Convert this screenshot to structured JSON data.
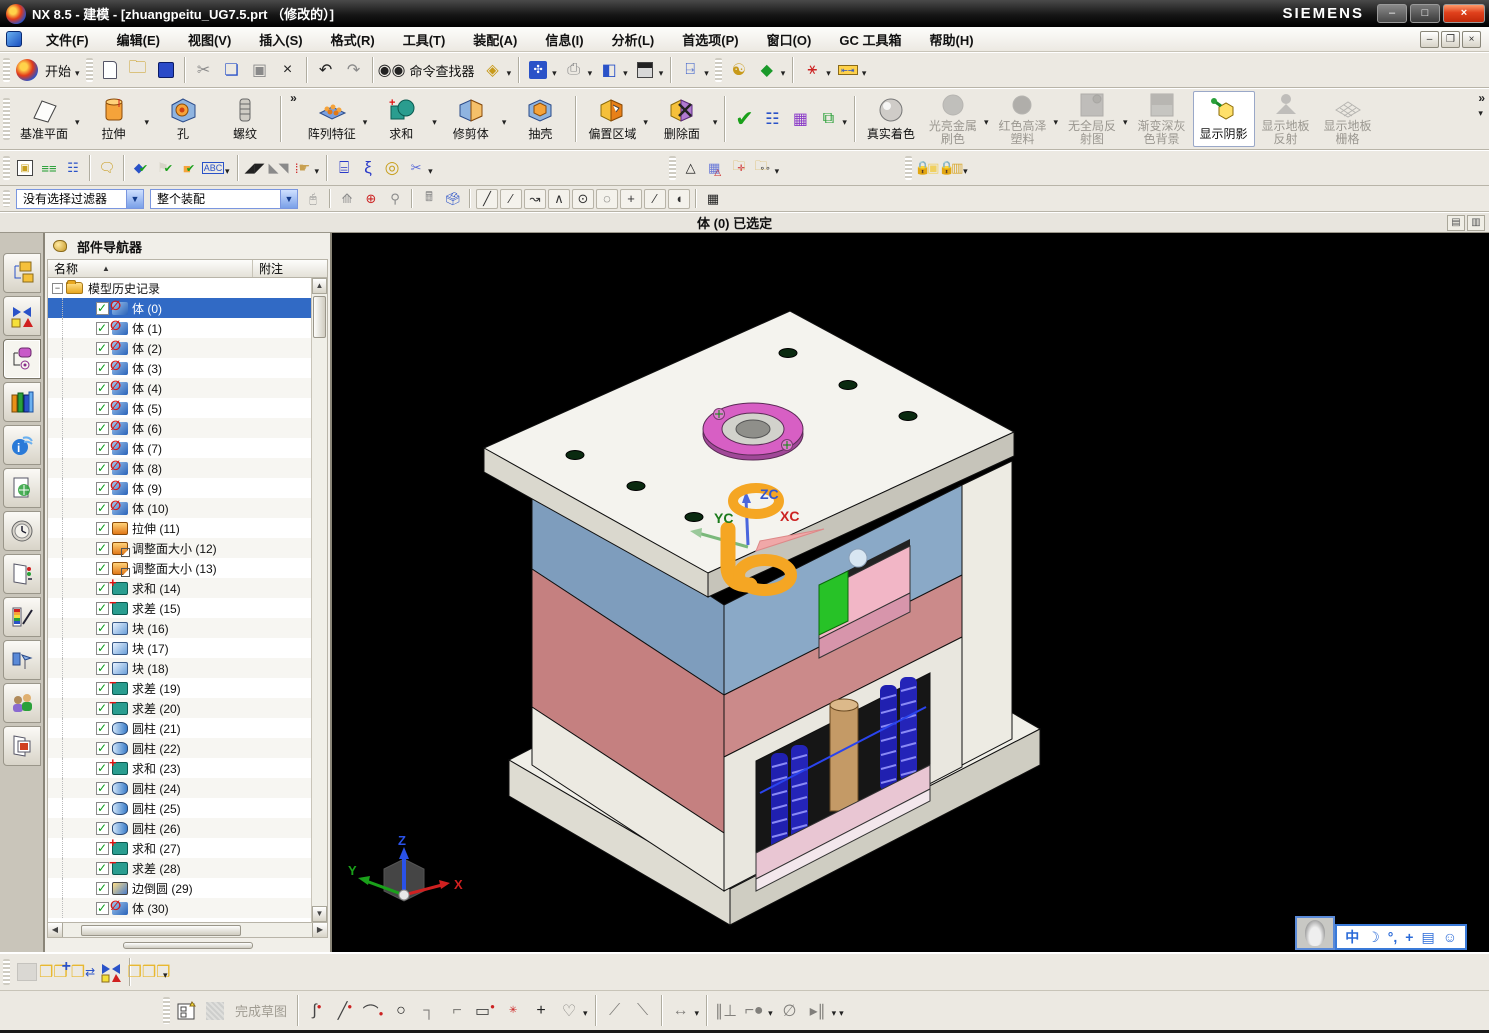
{
  "window": {
    "title": "NX 8.5 - 建模 - [zhuangpeitu_UG7.5.prt （修改的）]",
    "brand": "SIEMENS",
    "min": "–",
    "max": "□",
    "close": "×"
  },
  "menus": [
    "文件(F)",
    "编辑(E)",
    "视图(V)",
    "插入(S)",
    "格式(R)",
    "工具(T)",
    "装配(A)",
    "信息(I)",
    "分析(L)",
    "首选项(P)",
    "窗口(O)",
    "GC 工具箱",
    "帮助(H)"
  ],
  "tb1": {
    "start_label": "开始",
    "command_finder_label": "命令查找器"
  },
  "features": {
    "items": [
      {
        "label": "基准平面"
      },
      {
        "label": "拉伸"
      },
      {
        "label": "孔"
      },
      {
        "label": "螺纹"
      },
      {
        "label": "阵列特征"
      },
      {
        "label": "求和"
      },
      {
        "label": "修剪体"
      },
      {
        "label": "抽壳"
      },
      {
        "label": "偏置区域"
      },
      {
        "label": "删除面"
      }
    ]
  },
  "render_styles": {
    "items": [
      {
        "label": "真实着色"
      },
      {
        "line1": "光亮金属",
        "line2": "刷色"
      },
      {
        "line1": "红色高泽",
        "line2": "塑料"
      },
      {
        "line1": "无全局反",
        "line2": "射图"
      },
      {
        "line1": "渐变深灰",
        "line2": "色背景"
      },
      {
        "label": "显示阴影"
      },
      {
        "line1": "显示地板",
        "line2": "反射"
      },
      {
        "line1": "显示地板",
        "line2": "栅格"
      }
    ]
  },
  "selection_bar": {
    "filter_value": "没有选择过滤器",
    "scope_value": "整个装配"
  },
  "status_bar": {
    "text": "体 (0) 已选定"
  },
  "navigator": {
    "title": "部件导航器",
    "col_name": "名称",
    "col_note": "附注",
    "root_label": "模型历史记录",
    "items": [
      {
        "label": "体 (0)",
        "icon": "body",
        "selected": true
      },
      {
        "label": "体 (1)",
        "icon": "body"
      },
      {
        "label": "体 (2)",
        "icon": "body"
      },
      {
        "label": "体 (3)",
        "icon": "body"
      },
      {
        "label": "体 (4)",
        "icon": "body"
      },
      {
        "label": "体 (5)",
        "icon": "body"
      },
      {
        "label": "体 (6)",
        "icon": "body"
      },
      {
        "label": "体 (7)",
        "icon": "body"
      },
      {
        "label": "体 (8)",
        "icon": "body"
      },
      {
        "label": "体 (9)",
        "icon": "body"
      },
      {
        "label": "体 (10)",
        "icon": "body"
      },
      {
        "label": "拉伸 (11)",
        "icon": "extrude"
      },
      {
        "label": "调整面大小 (12)",
        "icon": "resize"
      },
      {
        "label": "调整面大小 (13)",
        "icon": "resize"
      },
      {
        "label": "求和 (14)",
        "icon": "unite"
      },
      {
        "label": "求差 (15)",
        "icon": "subtract"
      },
      {
        "label": "块 (16)",
        "icon": "block"
      },
      {
        "label": "块 (17)",
        "icon": "block"
      },
      {
        "label": "块 (18)",
        "icon": "block"
      },
      {
        "label": "求差 (19)",
        "icon": "subtract"
      },
      {
        "label": "求差 (20)",
        "icon": "subtract"
      },
      {
        "label": "圆柱 (21)",
        "icon": "cylinder"
      },
      {
        "label": "圆柱 (22)",
        "icon": "cylinder"
      },
      {
        "label": "求和 (23)",
        "icon": "unite"
      },
      {
        "label": "圆柱 (24)",
        "icon": "cylinder"
      },
      {
        "label": "圆柱 (25)",
        "icon": "cylinder"
      },
      {
        "label": "圆柱 (26)",
        "icon": "cylinder"
      },
      {
        "label": "求和 (27)",
        "icon": "unite"
      },
      {
        "label": "求差 (28)",
        "icon": "subtract"
      },
      {
        "label": "边倒圆 (29)",
        "icon": "blend"
      },
      {
        "label": "体 (30)",
        "icon": "body"
      }
    ]
  },
  "viewport": {
    "wcs": {
      "x": "XC",
      "y": "YC",
      "z": "ZC"
    },
    "triad": {
      "x": "X",
      "y": "Y",
      "z": "Z"
    },
    "ime_items": [
      "中",
      "☽",
      "°,",
      "+",
      "▤",
      "☺"
    ]
  },
  "sketch_bar": {
    "finish_label": "完成草图"
  },
  "colors": {
    "selection": "#316ac5",
    "viewport_bg": "#000000",
    "plate_blue": "#7e9dbd",
    "plate_salmon": "#c58080",
    "ring_pink": "#d75fc4",
    "handle_orange": "#f5a623"
  }
}
